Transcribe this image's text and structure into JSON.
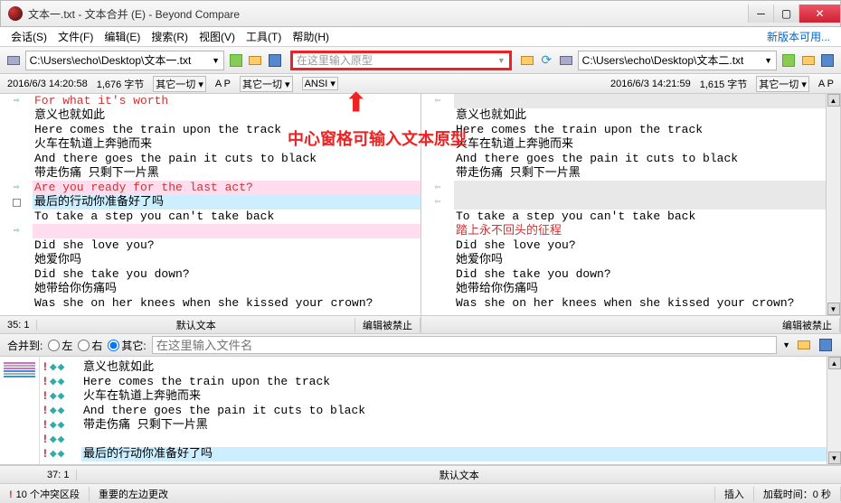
{
  "title": "文本一.txt - 文本合并 (E) - Beyond Compare",
  "menu": {
    "session": "会话(S)",
    "file": "文件(F)",
    "edit": "编辑(E)",
    "search": "搜索(R)",
    "view": "视图(V)",
    "tools": "工具(T)",
    "help": "帮助(H)",
    "update": "新版本可用..."
  },
  "paths": {
    "left": "C:\\Users\\echo\\Desktop\\文本一.txt",
    "center_placeholder": "在这里输入原型",
    "right": "C:\\Users\\echo\\Desktop\\文本二.txt"
  },
  "stats": {
    "left": {
      "date": "2016/6/3 14:20:58",
      "bytes": "1,676 字节",
      "filter": "其它一切",
      "ap": "A  P"
    },
    "center": {
      "filter": "其它一切",
      "enc": "ANSI"
    },
    "right": {
      "date": "2016/6/3 14:21:59",
      "bytes": "1,615 字节",
      "filter": "其它一切",
      "ap": "A  P"
    }
  },
  "annotation": "中心窗格可输入文本原型",
  "leftLines": [
    {
      "g": "r",
      "t": "For what it's worth",
      "cls": "red"
    },
    {
      "g": "",
      "t": "意义也就如此"
    },
    {
      "g": "",
      "t": "Here comes the train upon the track"
    },
    {
      "g": "",
      "t": "火车在轨道上奔驰而来"
    },
    {
      "g": "",
      "t": "And there goes the pain it cuts to black"
    },
    {
      "g": "",
      "t": "带走伤痛 只剩下一片黑"
    },
    {
      "g": "r",
      "t": "Are you ready for the last act?",
      "cls": "red bg-pink"
    },
    {
      "g": "sq",
      "t": "最后的行动你准备好了吗",
      "cls": "bg-cyan"
    },
    {
      "g": "",
      "t": "To take a step you can't take back"
    },
    {
      "g": "r",
      "t": "",
      "cls": "bg-pink"
    },
    {
      "g": "",
      "t": "Did she love you?"
    },
    {
      "g": "",
      "t": "她爱你吗"
    },
    {
      "g": "",
      "t": "Did she take you down?"
    },
    {
      "g": "",
      "t": "她带给你伤痛吗"
    },
    {
      "g": "",
      "t": "Was she on her knees when she kissed your crown?"
    }
  ],
  "rightLines": [
    {
      "g": "l",
      "t": "",
      "cls": "bg-gray"
    },
    {
      "g": "",
      "t": "意义也就如此"
    },
    {
      "g": "",
      "t": "Here comes the train upon the track"
    },
    {
      "g": "",
      "t": "火车在轨道上奔驰而来"
    },
    {
      "g": "",
      "t": "And there goes the pain it cuts to black"
    },
    {
      "g": "",
      "t": "带走伤痛 只剩下一片黑"
    },
    {
      "g": "l",
      "t": "",
      "cls": "bg-gray"
    },
    {
      "g": "l",
      "t": "",
      "cls": "bg-gray"
    },
    {
      "g": "",
      "t": "To take a step you can't take back"
    },
    {
      "g": "",
      "t": "踏上永不回头的征程",
      "cls": "red"
    },
    {
      "g": "",
      "t": "Did she love you?"
    },
    {
      "g": "",
      "t": "她爱你吗"
    },
    {
      "g": "",
      "t": "Did she take you down?"
    },
    {
      "g": "",
      "t": "她带给你伤痛吗"
    },
    {
      "g": "",
      "t": "Was she on her knees when she kissed your crown?"
    }
  ],
  "paneFoot": {
    "leftPos": "35: 1",
    "leftMode": "默认文本",
    "leftEdit": "编辑被禁止",
    "rightEdit": "编辑被禁止"
  },
  "mergeBar": {
    "label": "合并到:",
    "optLeft": "左",
    "optRight": "右",
    "optOther": "其它:",
    "placeholder": "在这里输入文件名"
  },
  "mergeLines": [
    {
      "t": "意义也就如此"
    },
    {
      "t": "Here comes the train upon the track"
    },
    {
      "t": "火车在轨道上奔驰而来"
    },
    {
      "t": "And there goes the pain it cuts to black"
    },
    {
      "t": "带走伤痛 只剩下一片黑"
    },
    {
      "t": ""
    },
    {
      "t": "最后的行动你准备好了吗",
      "cls": "bg-cyan"
    }
  ],
  "mergeFoot": {
    "pos": "37: 1",
    "mode": "默认文本"
  },
  "status": {
    "conflicts": "10 个冲突区段",
    "important": "重要的左边更改",
    "sec": "0 秒",
    "load": "加载时间：0 秒",
    "ins": "插入"
  }
}
